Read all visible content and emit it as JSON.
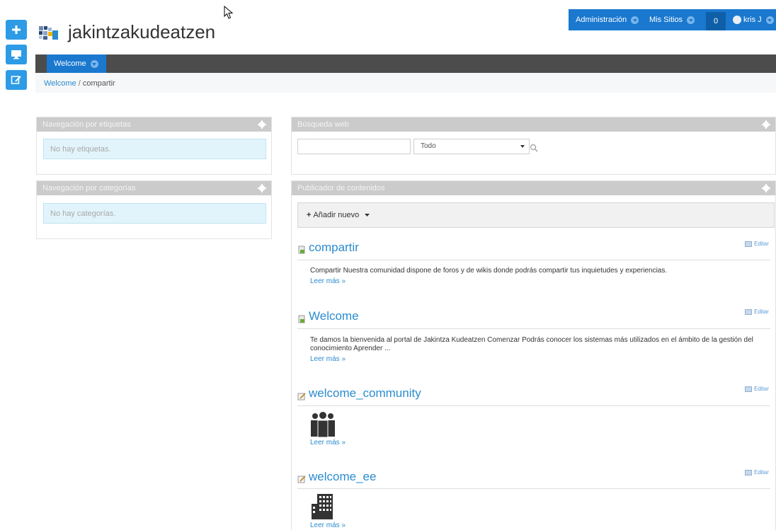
{
  "dockbar": {
    "admin_label": "Administración",
    "sites_label": "Mis Sitios",
    "notifications": "0",
    "user_label": "kris J"
  },
  "site": {
    "title": "jakintzakudeatzen"
  },
  "nav": {
    "tab_label": "Welcome"
  },
  "breadcrumb": {
    "parent": "Welcome",
    "separator": " / ",
    "current": "compartir"
  },
  "tags_portlet": {
    "title": "Navegación por etiquetas",
    "empty_message": "No hay etiquetas."
  },
  "categories_portlet": {
    "title": "Navegación por categorías",
    "empty_message": "No hay categorías."
  },
  "search_portlet": {
    "title": "Búsqueda web",
    "query": "",
    "scope_selected": "Todo"
  },
  "publisher_portlet": {
    "title": "Publicador de contenidos",
    "add_new_label": "Añadir nuevo",
    "edit_label": "Editar",
    "read_more_label": "Leer más »",
    "assets": [
      {
        "title": "compartir",
        "summary": "Compartir Nuestra comunidad dispone de foros y de wikis donde podrás compartir tus inquietudes y experiencias."
      },
      {
        "title": "Welcome",
        "summary": "Te damos la bienvenida al portal de Jakintza Kudeatzen Comenzar Podrás conocer los sistemas más utilizados en el ámbito de la gestión del conocimiento   Aprender ..."
      },
      {
        "title": "welcome_community",
        "image": "people-icon"
      },
      {
        "title": "welcome_ee",
        "image": "building-icon"
      }
    ]
  },
  "colors": {
    "accent": "#1a78cf",
    "link": "#2a8ccf",
    "nav_bg": "#4c4c4c",
    "portlet_header": "#cbcbcb"
  }
}
